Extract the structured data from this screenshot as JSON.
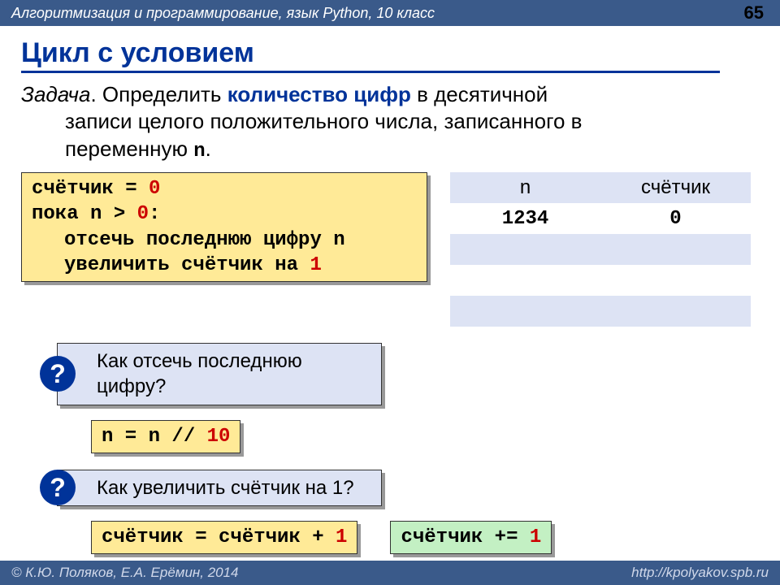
{
  "header": {
    "course": "Алгоритмизация и программирование, язык Python, 10 класс",
    "page": "65"
  },
  "title": "Цикл с условием",
  "task": {
    "label": "Задача",
    "text1": ". Определить ",
    "highlight": "количество цифр",
    "text2": " в десятичной",
    "line2": "записи целого положительного числа, записанного в",
    "line3_a": "переменную ",
    "var": "n",
    "line3_b": "."
  },
  "code1": {
    "l1a": "счётчик = ",
    "l1b": "0",
    "l2a": "пока n > ",
    "l2b": "0",
    "l2c": ":",
    "l3": "отсечь последнюю цифру n",
    "l4a": "увеличить счётчик на ",
    "l4b": "1"
  },
  "q1": "Как отсечь последнюю цифру?",
  "code2": {
    "a": "n = n // ",
    "b": "10"
  },
  "q2": "Как увеличить счётчик на 1?",
  "code3": {
    "a": "счётчик = счётчик + ",
    "b": "1"
  },
  "code4": {
    "a": "счётчик += ",
    "b": "1"
  },
  "trace": {
    "h1": "n",
    "h2": "счётчик",
    "r1c1": "1234",
    "r1c2": "0"
  },
  "footer": {
    "left": "© К.Ю. Поляков, Е.А. Ерёмин, 2014",
    "right": "http://kpolyakov.spb.ru"
  },
  "qmark": "?"
}
